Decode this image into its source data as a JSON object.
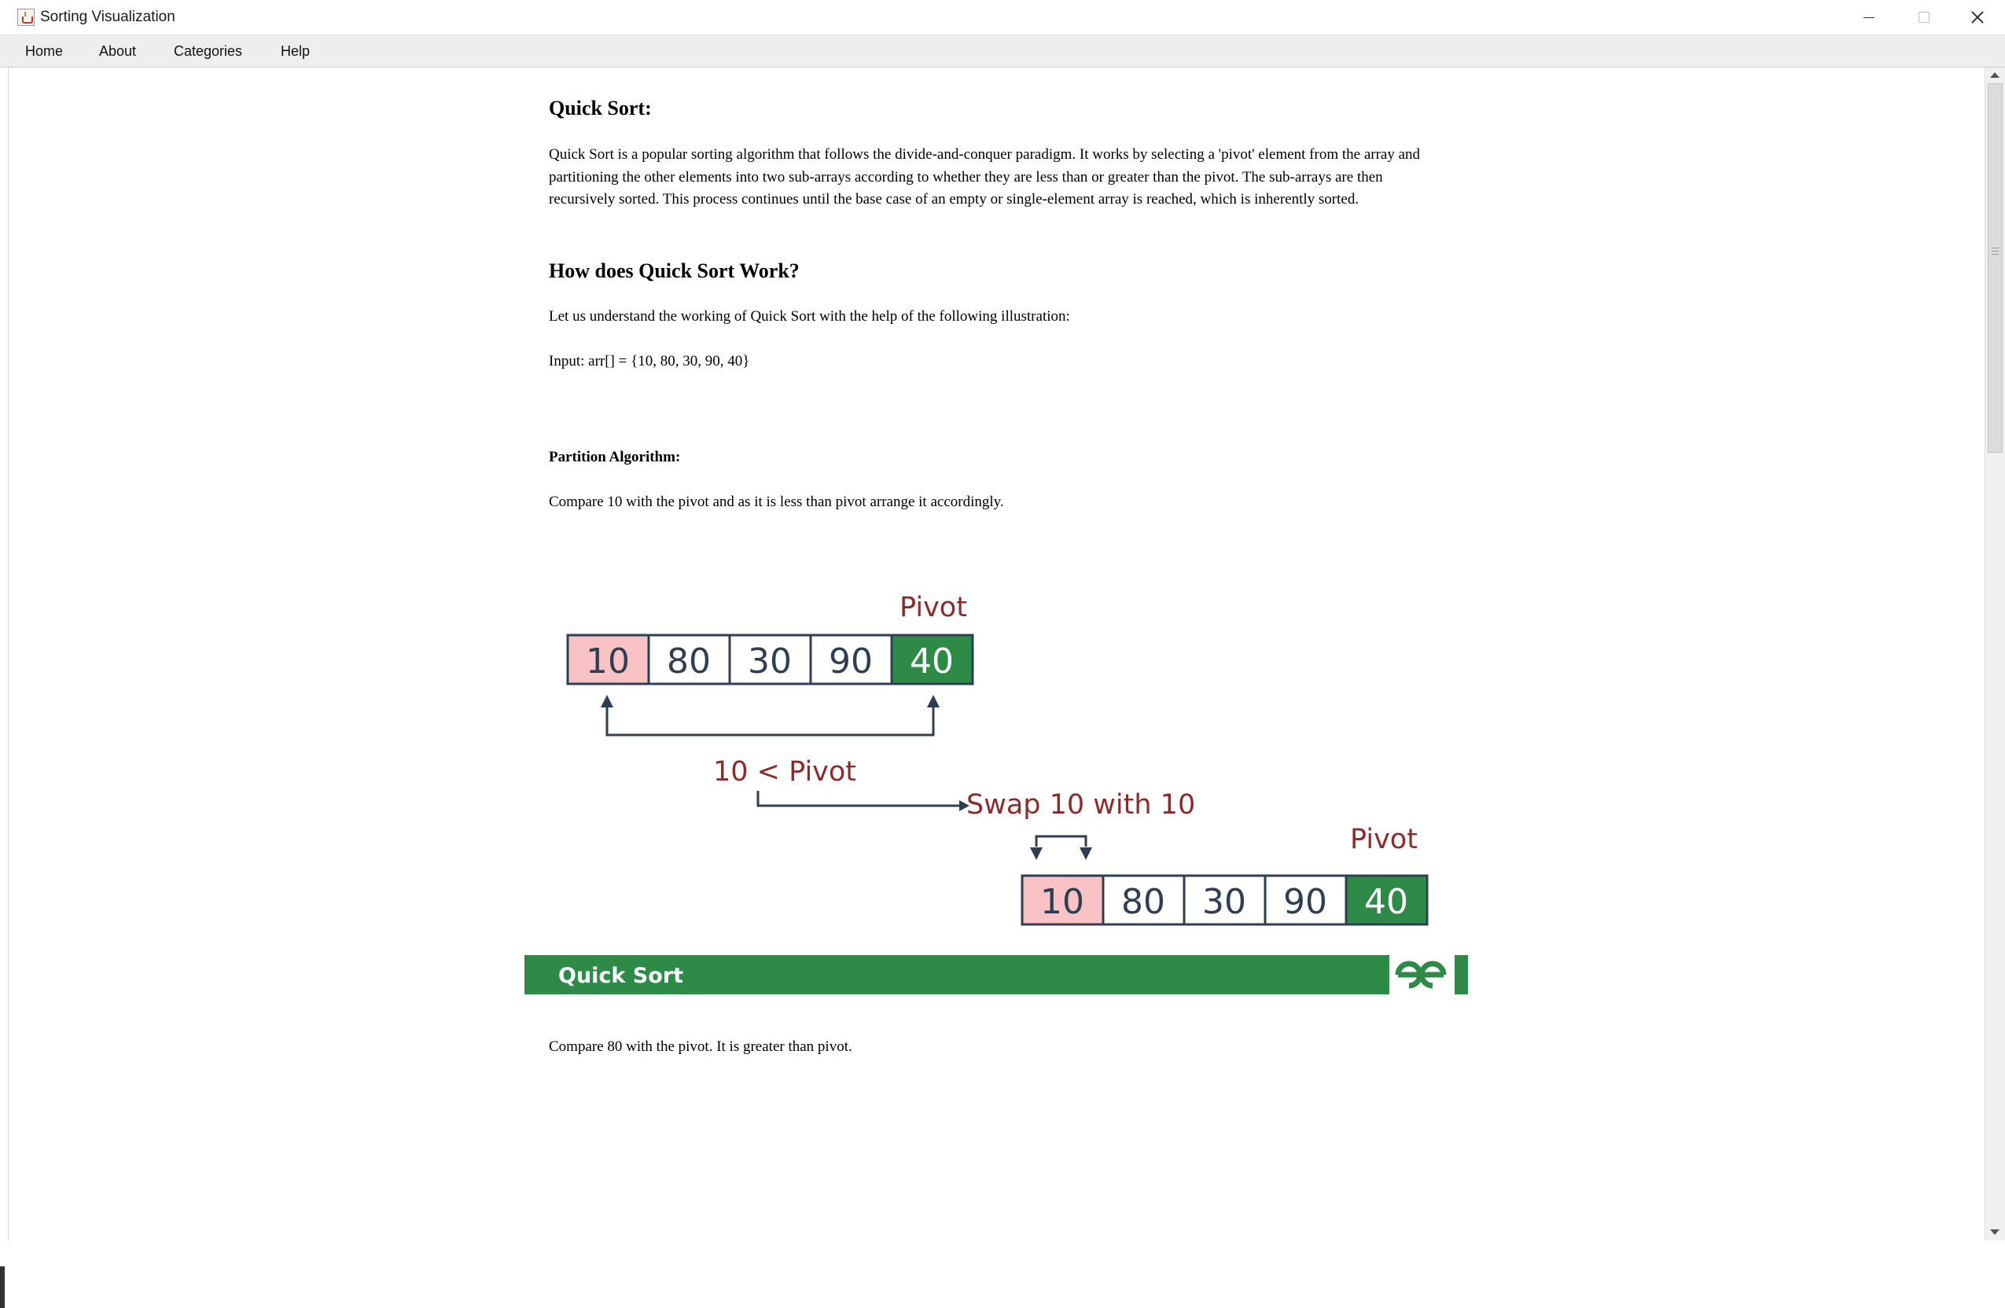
{
  "window": {
    "title": "Sorting Visualization"
  },
  "menu": {
    "items": [
      "Home",
      "About",
      "Categories",
      "Help"
    ]
  },
  "article": {
    "title": "Quick Sort:",
    "intro": "Quick Sort is a popular sorting algorithm that follows the divide-and-conquer paradigm. It works by selecting a 'pivot' element from the array and partitioning the other elements into two sub-arrays according to whether they are less than or greater than the pivot. The sub-arrays are then recursively sorted. This process continues until the base case of an empty or single-element array is reached, which is inherently sorted.",
    "how_heading": "How does Quick Sort Work?",
    "lets_text": "Let us understand the working of Quick Sort with the help of the following illustration:",
    "input_text": "Input: arr[] = {10, 80, 30, 90, 40}",
    "partition_heading": "Partition Algorithm:",
    "compare10_text": "Compare 10 with the pivot and as it is less than pivot arrange it accordingly.",
    "compare80_text": "Compare 80 with the pivot. It is greater than pivot."
  },
  "illustration": {
    "pivot_label": "Pivot",
    "array_top": [
      "10",
      "80",
      "30",
      "90",
      "40"
    ],
    "array_bottom": [
      "10",
      "80",
      "30",
      "90",
      "40"
    ],
    "condition_label": "10 < Pivot",
    "swap_label": "Swap 10 with 10",
    "banner_label": "Quick Sort",
    "logo_text": "GfG",
    "colors": {
      "pivot_cell": "#2e8b47",
      "compared_cell": "#f9c2c4",
      "label_red": "#8b2c2c",
      "outline": "#2f3f52",
      "banner_green": "#2e8b47"
    }
  }
}
